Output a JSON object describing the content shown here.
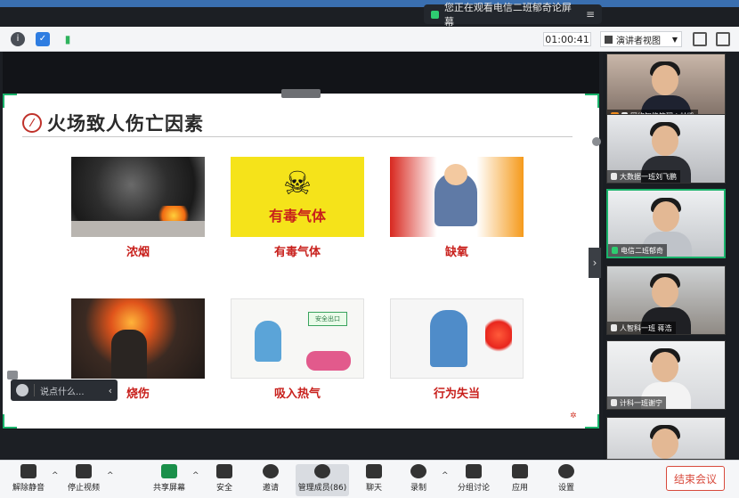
{
  "banner": {
    "text": "您正在观看电信二班郁奇论屏幕",
    "menu_icon": "≡"
  },
  "topbar": {
    "timer": "01:00:41",
    "view_label": "演讲者视图"
  },
  "slide": {
    "title": "火场致人伤亡因素",
    "items": [
      {
        "label": "浓烟"
      },
      {
        "label": "有毒气体",
        "sign_text": "有毒气体"
      },
      {
        "label": "缺氧"
      },
      {
        "label": "烧伤"
      },
      {
        "label": "吸入热气",
        "sign_text": "安全出口"
      },
      {
        "label": "行为失当"
      }
    ]
  },
  "chat": {
    "placeholder": "说点什么..."
  },
  "participants": [
    {
      "name": "网络智能管理 | 林凯",
      "host": true
    },
    {
      "name": "大数据一班刘飞鹏"
    },
    {
      "name": "电信二班郁奇",
      "active": true
    },
    {
      "name": "人智科一班 蒋浩"
    },
    {
      "name": "计科一班谢宁"
    },
    {
      "name": ""
    }
  ],
  "toolbar": {
    "items": [
      {
        "label": "解除静音"
      },
      {
        "label": "停止视频"
      },
      {
        "label": "共享屏幕"
      },
      {
        "label": "安全"
      },
      {
        "label": "邀请"
      },
      {
        "label": "管理成员(86)"
      },
      {
        "label": "聊天"
      },
      {
        "label": "录制"
      },
      {
        "label": "分组讨论"
      },
      {
        "label": "应用"
      },
      {
        "label": "设置"
      }
    ],
    "end_label": "结束会议"
  },
  "colors": {
    "accent_green": "#19b36b",
    "alert_red": "#c8201c",
    "end_red": "#d84a3c"
  }
}
